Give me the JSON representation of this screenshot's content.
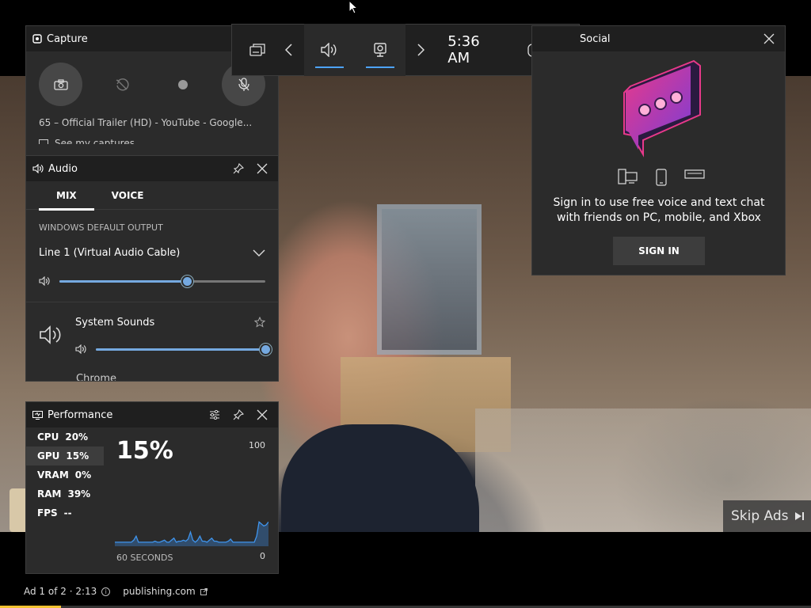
{
  "video": {
    "skip_label": "Skip Ads",
    "ad_counter": "Ad 1 of 2 · 2:13",
    "advertiser": "publishing.com",
    "progress_fraction": 0.075
  },
  "topbar": {
    "time": "5:36 AM"
  },
  "capture": {
    "title": "Capture",
    "media_title": "65 – Official Trailer (HD) - YouTube - Google...",
    "see_captures": "See my captures"
  },
  "audio": {
    "title": "Audio",
    "tabs": [
      {
        "label": "MIX",
        "active": true
      },
      {
        "label": "VOICE",
        "active": false
      }
    ],
    "output_label": "WINDOWS DEFAULT OUTPUT",
    "device": "Line 1 (Virtual Audio Cable)",
    "master_volume": 0.62,
    "apps": [
      {
        "name": "System Sounds",
        "volume": 1.0
      }
    ],
    "next_app": "Chrome"
  },
  "performance": {
    "title": "Performance",
    "metrics": [
      {
        "label": "CPU",
        "value": "20%",
        "active": false
      },
      {
        "label": "GPU",
        "value": "15%",
        "active": true
      },
      {
        "label": "VRAM",
        "value": "0%",
        "active": false
      },
      {
        "label": "RAM",
        "value": "39%",
        "active": false
      },
      {
        "label": "FPS",
        "value": "--",
        "active": false
      }
    ],
    "big_value": "15%",
    "max_label": "100",
    "min_label": "0",
    "axis_label": "60 SECONDS",
    "history": [
      4,
      4,
      4,
      4,
      4,
      4,
      4,
      4,
      6,
      10,
      4,
      4,
      4,
      4,
      4,
      4,
      4,
      5,
      4,
      4,
      5,
      6,
      4,
      4,
      6,
      8,
      4,
      5,
      5,
      6,
      5,
      7,
      14,
      6,
      4,
      6,
      10,
      5,
      5,
      4,
      6,
      8,
      5,
      5,
      4,
      4,
      4,
      4,
      5,
      7,
      4,
      4,
      4,
      4,
      4,
      4,
      4,
      4,
      4,
      4,
      10,
      24,
      22,
      20,
      21,
      24
    ]
  },
  "social": {
    "title": "Social",
    "message": "Sign in to use free voice and text chat with friends on PC, mobile, and Xbox",
    "sign_in_label": "SIGN IN"
  },
  "colors": {
    "accent": "#4da3ff",
    "slider": "#75a9e0",
    "ad_progress": "#f2c230",
    "social_pink": "#e8398a",
    "social_purple": "#7a3dd6"
  }
}
